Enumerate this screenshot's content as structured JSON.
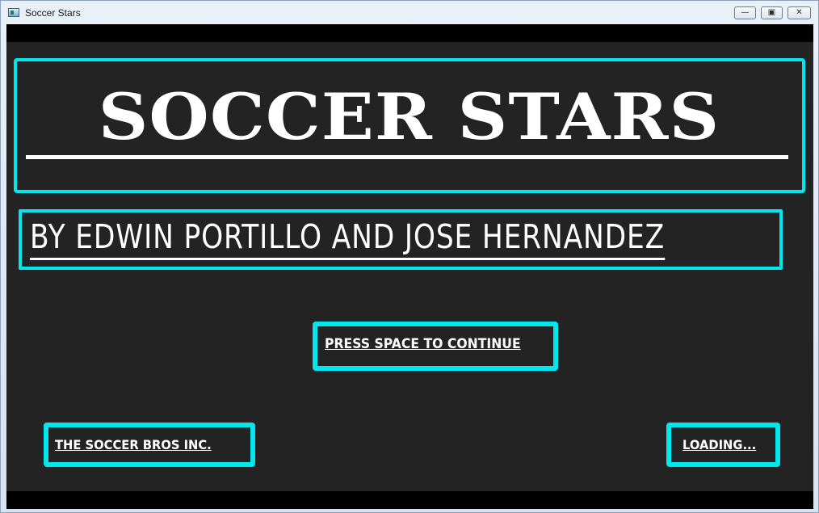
{
  "window": {
    "title": "Soccer Stars",
    "minimize_symbol": "—",
    "maximize_symbol": "▣",
    "close_symbol": "✕"
  },
  "screen": {
    "game_title": "SOCCER STARS",
    "credits": "BY EDWIN PORTILLO AND JOSE HERNANDEZ",
    "continue_prompt": "PRESS SPACE TO CONTINUE",
    "company": "THE SOCCER BROS INC.",
    "status": "LOADING..."
  },
  "colors": {
    "accent": "#00e8ee",
    "background": "#232323",
    "text": "#ffffff"
  },
  "icons": {
    "app": "app-window-icon",
    "minimize": "minimize-icon",
    "maximize": "maximize-icon",
    "close": "close-icon"
  }
}
